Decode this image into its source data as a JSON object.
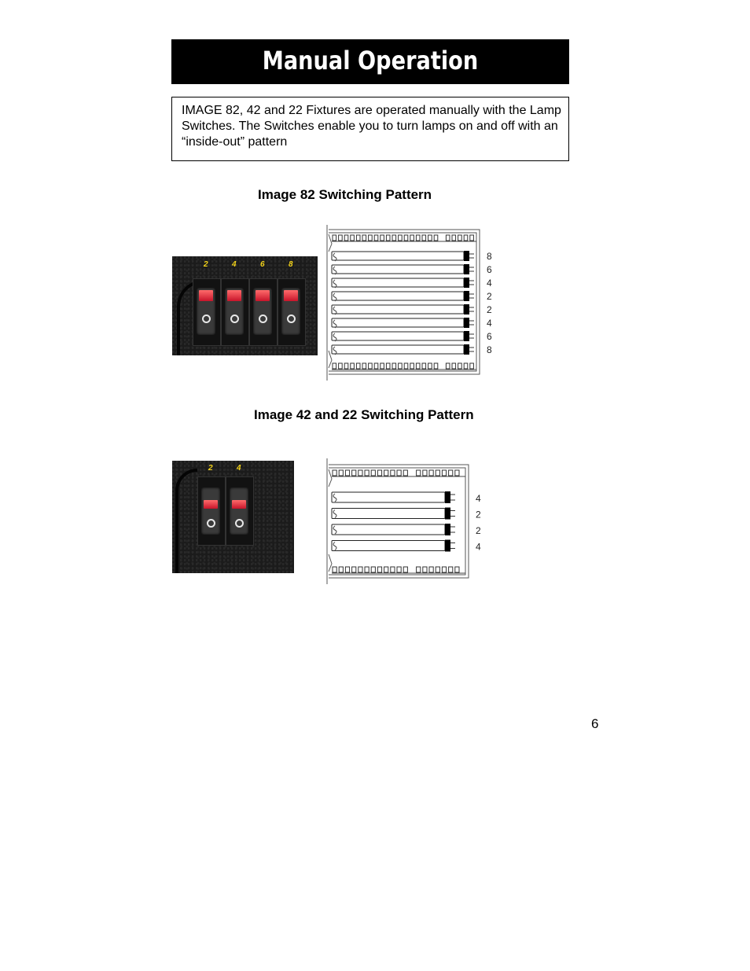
{
  "page": {
    "title": "Manual Operation",
    "intro": "IMAGE 82, 42 and 22 Fixtures are operated manually with the Lamp Switches. The Switches enable you to turn lamps on and off with an “inside-out” pattern",
    "page_number": "6"
  },
  "sections": [
    {
      "heading": "Image 82 Switching Pattern",
      "switch_labels": [
        "2",
        "4",
        "6",
        "8"
      ],
      "lamp_labels": [
        "8",
        "6",
        "4",
        "2",
        "2",
        "4",
        "6",
        "8"
      ]
    },
    {
      "heading": "Image 42 and 22 Switching Pattern",
      "switch_labels": [
        "2",
        "4"
      ],
      "lamp_labels": [
        "4",
        "2",
        "2",
        "4"
      ]
    }
  ],
  "colors": {
    "title_bg": "#000000",
    "title_text": "#ffffff",
    "switch_red": "#d81f32",
    "switch_label": "#f2d21a"
  }
}
